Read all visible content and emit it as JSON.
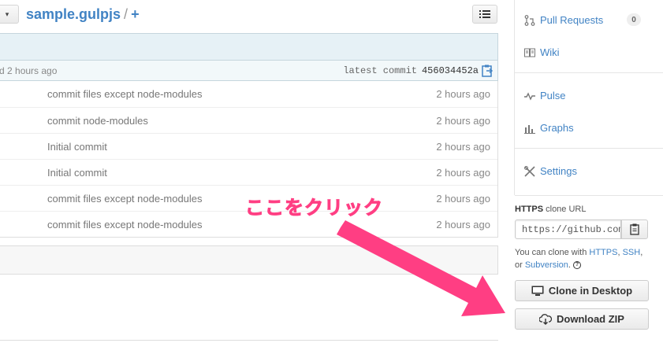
{
  "header": {
    "repo_name": "sample.gulpjs",
    "separator": "/",
    "plus": "+"
  },
  "commit_bar": {
    "left_text": "d 2 hours ago",
    "latest_label": "latest commit",
    "sha": "456034452a"
  },
  "files": [
    {
      "message": "commit files except node-modules",
      "age": "2 hours ago"
    },
    {
      "message": "commit node-modules",
      "age": "2 hours ago"
    },
    {
      "message": "Initial commit",
      "age": "2 hours ago"
    },
    {
      "message": "Initial commit",
      "age": "2 hours ago"
    },
    {
      "message": "commit files except node-modules",
      "age": "2 hours ago"
    },
    {
      "message": "commit files except node-modules",
      "age": "2 hours ago"
    }
  ],
  "sidebar": {
    "nav": [
      {
        "label": "Pull Requests",
        "icon": "pull-request-icon"
      },
      {
        "label": "Wiki",
        "icon": "book-icon"
      },
      {
        "label": "Pulse",
        "icon": "pulse-icon"
      },
      {
        "label": "Graphs",
        "icon": "graph-icon"
      },
      {
        "label": "Settings",
        "icon": "tools-icon"
      }
    ],
    "pull_request_count": "0"
  },
  "clone": {
    "protocol": "HTTPS",
    "title_suffix": "clone URL",
    "url": "https://github.com",
    "help_prefix": "You can clone with",
    "https_link": "HTTPS",
    "ssh_link": "SSH",
    "or_text": "or",
    "subversion_link": "Subversion",
    "help_mark": "?",
    "clone_desktop_label": "Clone in Desktop",
    "download_zip_label": "Download ZIP"
  },
  "annotation": {
    "text": "ここをクリック"
  },
  "colors": {
    "link": "#4183c4",
    "annotation": "#ff3e83",
    "commit_tease_bg": "#e6f1f6"
  }
}
